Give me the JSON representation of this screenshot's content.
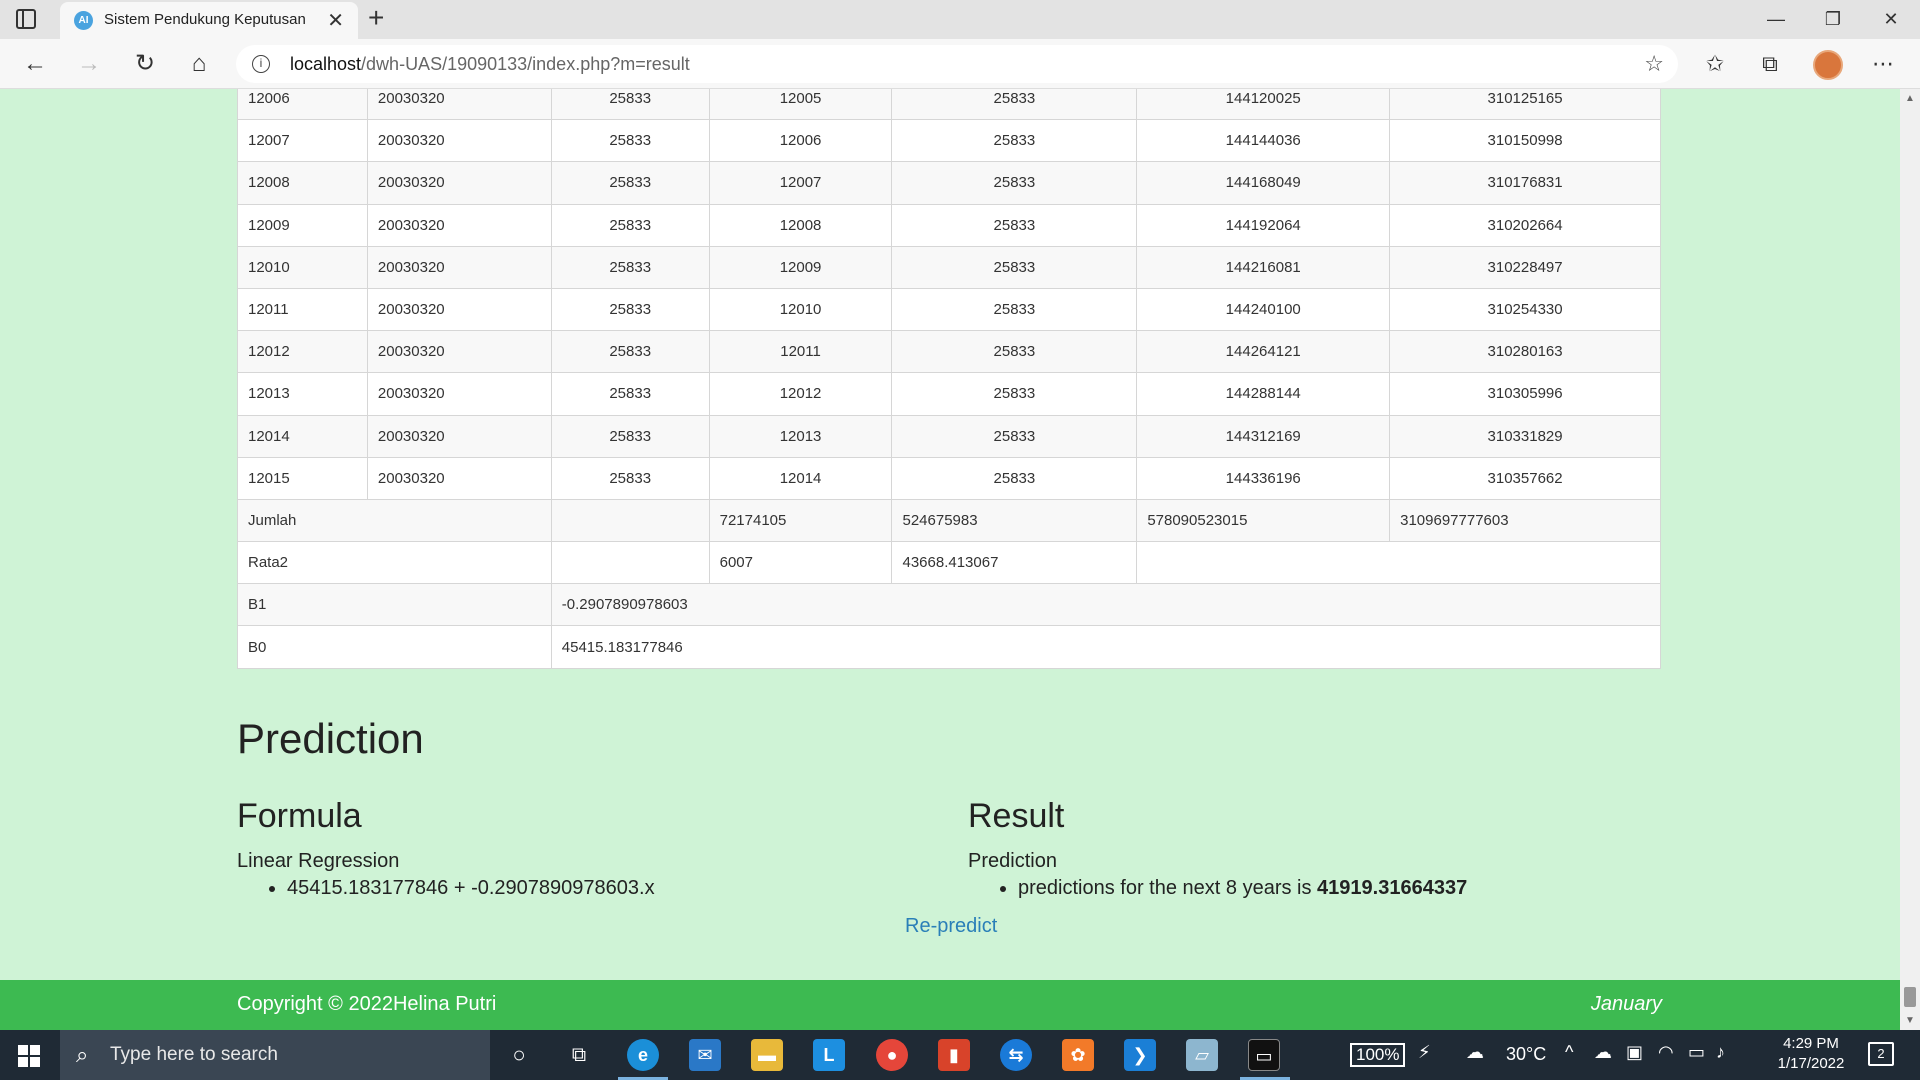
{
  "browser": {
    "tab_title": "Sistem Pendukung Keputusan",
    "url_host": "localhost",
    "url_path": "/dwh-UAS/19090133/index.php?m=result"
  },
  "table": {
    "rows": [
      [
        "12006",
        "20030320",
        "25833",
        "12005",
        "25833",
        "144120025",
        "310125165"
      ],
      [
        "12007",
        "20030320",
        "25833",
        "12006",
        "25833",
        "144144036",
        "310150998"
      ],
      [
        "12008",
        "20030320",
        "25833",
        "12007",
        "25833",
        "144168049",
        "310176831"
      ],
      [
        "12009",
        "20030320",
        "25833",
        "12008",
        "25833",
        "144192064",
        "310202664"
      ],
      [
        "12010",
        "20030320",
        "25833",
        "12009",
        "25833",
        "144216081",
        "310228497"
      ],
      [
        "12011",
        "20030320",
        "25833",
        "12010",
        "25833",
        "144240100",
        "310254330"
      ],
      [
        "12012",
        "20030320",
        "25833",
        "12011",
        "25833",
        "144264121",
        "310280163"
      ],
      [
        "12013",
        "20030320",
        "25833",
        "12012",
        "25833",
        "144288144",
        "310305996"
      ],
      [
        "12014",
        "20030320",
        "25833",
        "12013",
        "25833",
        "144312169",
        "310331829"
      ],
      [
        "12015",
        "20030320",
        "25833",
        "12014",
        "25833",
        "144336196",
        "310357662"
      ]
    ],
    "jumlah": {
      "label": "Jumlah",
      "sum_x": "72174105",
      "sum_y": "524675983",
      "sum_x2": "578090523015",
      "sum_xy": "3109697777603"
    },
    "rata2": {
      "label": "Rata2",
      "mean_x": "6007",
      "mean_y": "43668.413067"
    },
    "b1": {
      "label": "B1",
      "value": "-0.2907890978603"
    },
    "b0": {
      "label": "B0",
      "value": "45415.183177846"
    }
  },
  "prediction": {
    "title": "Prediction",
    "formula": {
      "heading": "Formula",
      "subtitle": "Linear Regression",
      "item": "45415.183177846 + -0.2907890978603.x"
    },
    "result": {
      "heading": "Result",
      "subtitle": "Prediction",
      "item_prefix": "predictions for the next 8 years is ",
      "item_value": "41919.31664337"
    },
    "repredict_label": "Re-predict"
  },
  "footer": {
    "copyright": "Copyright © 2022Helina Putri",
    "month": "January"
  },
  "taskbar": {
    "search_placeholder": "Type here to search",
    "battery": "100%",
    "weather": "30°C",
    "time": "4:29 PM",
    "date": "1/17/2022",
    "notifications": "2"
  }
}
